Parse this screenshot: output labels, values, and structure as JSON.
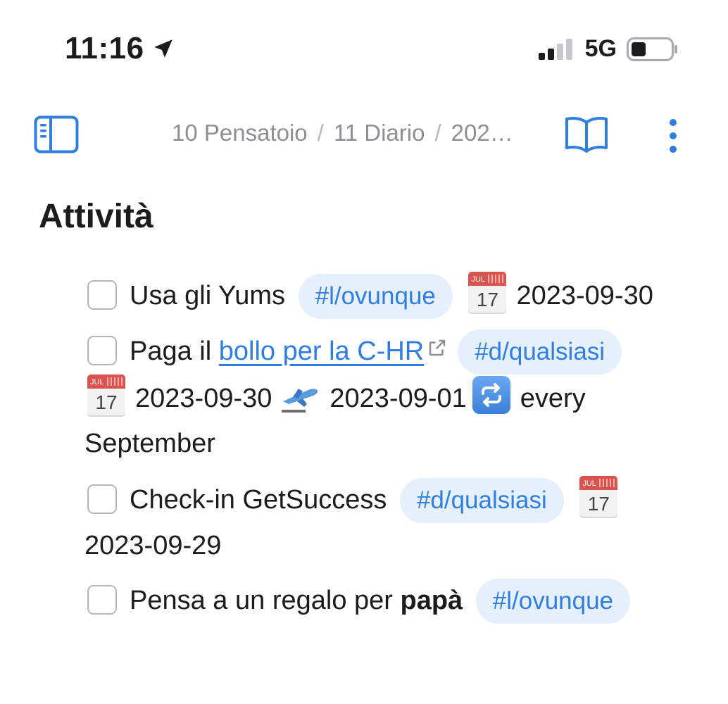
{
  "status_bar": {
    "time": "11:16",
    "network": "5G"
  },
  "header": {
    "breadcrumb": [
      "10 Pensatoio",
      "11 Diario",
      "202…"
    ]
  },
  "main": {
    "title": "Attività",
    "tasks": [
      {
        "text": "Usa gli Yums",
        "tag": "#l/ovunque",
        "calendar_month": "JUL",
        "calendar_day": "17",
        "due": "2023-09-30"
      },
      {
        "text_prefix": "Paga il",
        "link": "bollo per la C-HR",
        "tag": "#d/qualsiasi",
        "calendar_month": "JUL",
        "calendar_day": "17",
        "due": "2023-09-30",
        "start": "2023-09-01",
        "recurrence": "every September"
      },
      {
        "text": "Check-in GetSuccess",
        "tag": "#d/qualsiasi",
        "calendar_month": "JUL",
        "calendar_day": "17",
        "due": "2023-09-29"
      },
      {
        "text_prefix": "Pensa a un regalo per",
        "text_bold": "papà",
        "tag": "#l/ovunque"
      }
    ]
  },
  "colors": {
    "accent": "#2f7ee0",
    "tag_bg": "#e5f0fc",
    "muted": "#8e8e93"
  }
}
